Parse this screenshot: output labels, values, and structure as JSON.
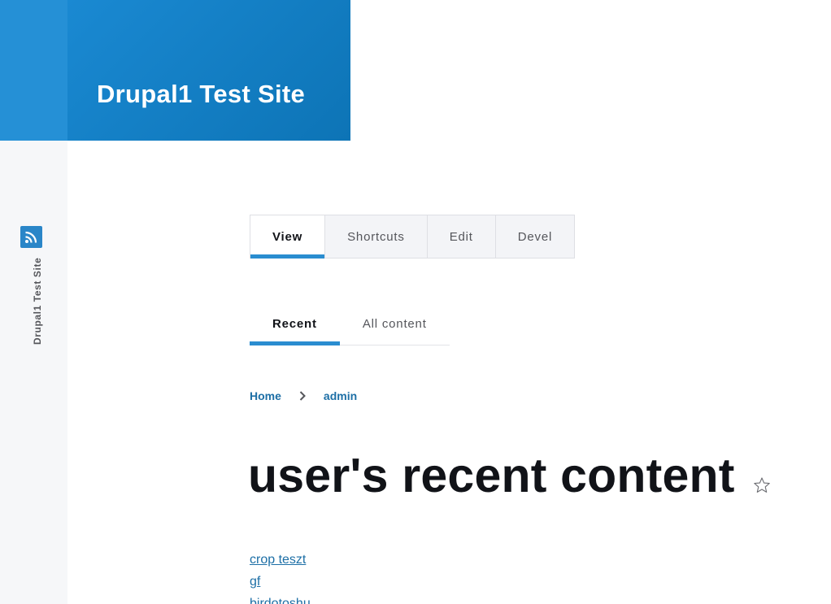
{
  "toolbar": {
    "vertical_label": "Drupal1 Test Site",
    "logo_icon": "wifi-signal-icon",
    "accent_color": "#2590d6"
  },
  "header": {
    "site_name": "Drupal1 Test Site",
    "brand_color": "#0d74b6"
  },
  "primary_tabs": [
    {
      "label": "View",
      "active": true
    },
    {
      "label": "Shortcuts",
      "active": false
    },
    {
      "label": "Edit",
      "active": false
    },
    {
      "label": "Devel",
      "active": false
    }
  ],
  "secondary_tabs": [
    {
      "label": "Recent",
      "active": true
    },
    {
      "label": "All content",
      "active": false
    }
  ],
  "breadcrumb": {
    "items": [
      "Home",
      "admin"
    ],
    "separator_icon": "chevron-right-icon"
  },
  "page": {
    "title": "user's recent content",
    "favorite_icon": "star-outline-icon"
  },
  "content_items": [
    "crop teszt",
    "gf",
    "birdotoshu"
  ]
}
